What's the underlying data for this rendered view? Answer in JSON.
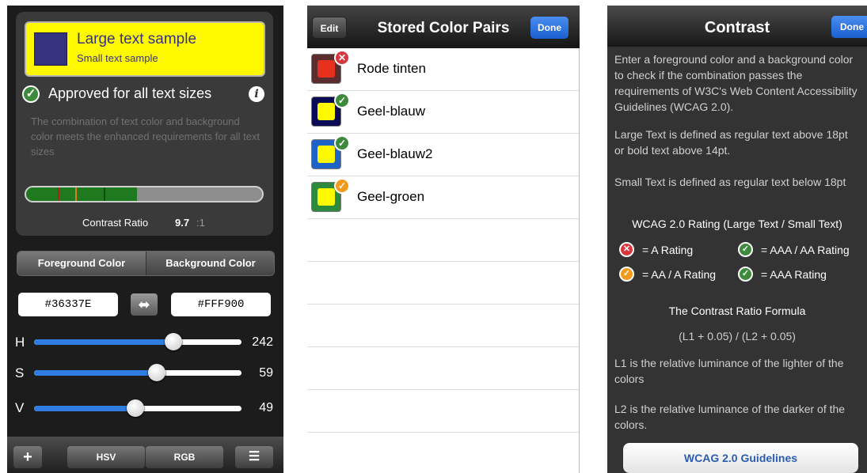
{
  "screen1": {
    "sample": {
      "large_text": "Large text sample",
      "small_text": "Small text sample",
      "swatch_color": "#36337E",
      "background_color": "#FFF900"
    },
    "status": {
      "label": "Approved for all text sizes",
      "description": "The combination of text color and background color meets the enhanced requirements for all text sizes"
    },
    "contrast": {
      "label": "Contrast Ratio",
      "value": "9.7",
      "unit": ":1",
      "bar_fill_fraction": 0.47
    },
    "segment": {
      "foreground_label": "Foreground Color",
      "background_label": "Background Color"
    },
    "foreground_hex": "#36337E",
    "background_hex": "#FFF900",
    "sliders": [
      {
        "label": "H",
        "value": "242",
        "fraction": 0.67
      },
      {
        "label": "S",
        "value": "59",
        "fraction": 0.59
      },
      {
        "label": "V",
        "value": "49",
        "fraction": 0.49
      }
    ],
    "toolbar": {
      "add_label": "+",
      "hsv_label": "HSV",
      "rgb_label": "RGB",
      "list_icon": "list-icon"
    }
  },
  "screen2": {
    "edit_label": "Edit",
    "title": "Stored Color Pairs",
    "done_label": "Done",
    "pairs": [
      {
        "name": "Rode tinten",
        "outer": "#5a2e2e",
        "inner": "#E8301E",
        "badge": "x",
        "badge_color": "#d9363e"
      },
      {
        "name": "Geel-blauw",
        "outer": "#0b0b55",
        "inner": "#FFF900",
        "badge": "check",
        "badge_color": "#3d8a3d"
      },
      {
        "name": "Geel-blauw2",
        "outer": "#1d63c8",
        "inner": "#FFF900",
        "badge": "check",
        "badge_color": "#3d8a3d"
      },
      {
        "name": "Geel-groen",
        "outer": "#2c8a3c",
        "inner": "#FFF900",
        "badge": "check",
        "badge_color": "#f29a1c"
      }
    ]
  },
  "screen3": {
    "title": "Contrast",
    "done_label": "Done",
    "intro": "Enter a foreground color and a background color to check if the combination passes the requirements of W3C's Web Content Accessibility Guidelines (WCAG 2.0).",
    "large_text_def": "Large Text is defined as regular text above 18pt or bold text above 14pt.",
    "small_text_def": "Small Text is defined as regular text below 18pt",
    "rating_heading": "WCAG 2.0 Rating (Large Text / Small Text)",
    "legend": [
      {
        "text": "= A Rating",
        "badge_color": "#d9363e",
        "symbol": "x"
      },
      {
        "text": "= AAA / AA Rating",
        "badge_color": "#3d8a3d",
        "symbol": "check"
      },
      {
        "text": "= AA / A Rating",
        "badge_color": "#f29a1c",
        "symbol": "check"
      },
      {
        "text": "= AAA Rating",
        "badge_color": "#3d8a3d",
        "symbol": "check-double"
      }
    ],
    "formula_heading": "The Contrast Ratio Formula",
    "formula": "(L1 + 0.05) / (L2 + 0.05)",
    "l1_def": "L1 is the relative luminance of the lighter of the colors",
    "l2_def": "L2 is the relative luminance of the darker of the colors.",
    "guidelines_button": "WCAG 2.0 Guidelines"
  }
}
